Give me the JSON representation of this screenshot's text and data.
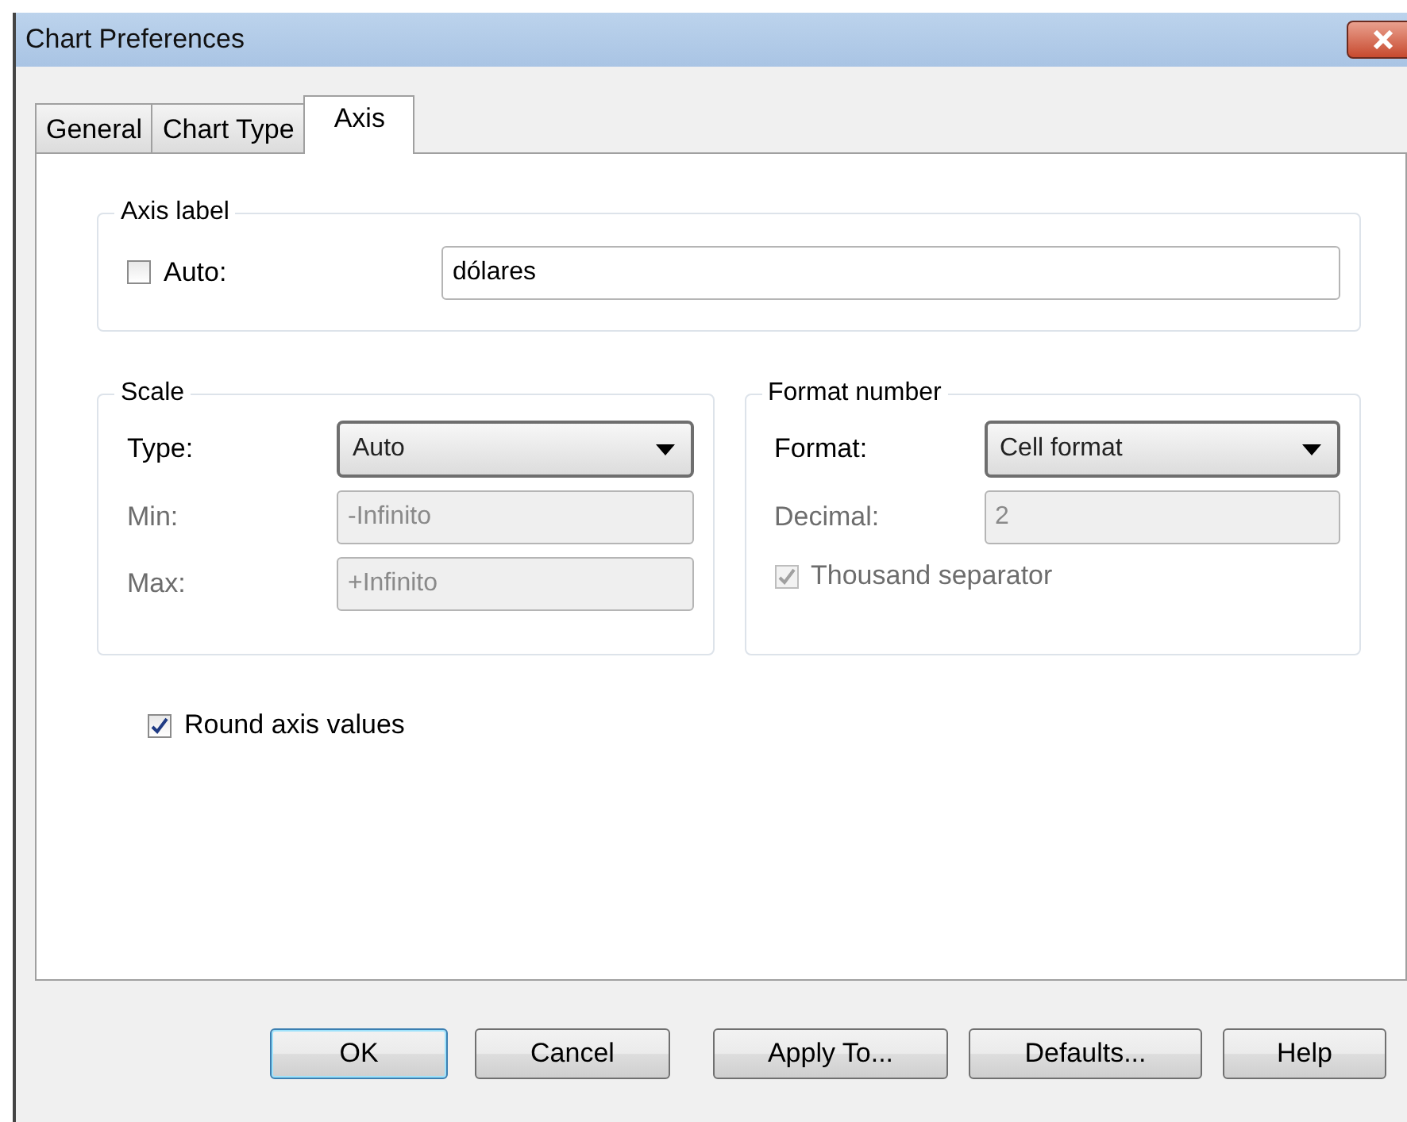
{
  "window": {
    "title": "Chart Preferences"
  },
  "tabs": [
    {
      "label": "General",
      "selected": false
    },
    {
      "label": "Chart Type",
      "selected": false
    },
    {
      "label": "Axis",
      "selected": true
    }
  ],
  "axis_label": {
    "title": "Axis label",
    "auto": {
      "label": "Auto:",
      "checked": false
    },
    "value": "dólares"
  },
  "scale": {
    "title": "Scale",
    "type": {
      "label": "Type:",
      "value": "Auto"
    },
    "min": {
      "label": "Min:",
      "value": "-Infinito",
      "disabled": true
    },
    "max": {
      "label": "Max:",
      "value": "+Infinito",
      "disabled": true
    }
  },
  "format_number": {
    "title": "Format number",
    "format": {
      "label": "Format:",
      "value": "Cell format"
    },
    "decimal": {
      "label": "Decimal:",
      "value": "2",
      "disabled": true
    },
    "thousand_separator": {
      "label": "Thousand separator",
      "checked": true,
      "disabled": true
    }
  },
  "round_axis_values": {
    "label": "Round axis values",
    "checked": true
  },
  "buttons": [
    {
      "label": "OK",
      "default": true
    },
    {
      "label": "Cancel",
      "default": false
    },
    {
      "label": "Apply To...",
      "default": false
    },
    {
      "label": "Defaults...",
      "default": false
    },
    {
      "label": "Help",
      "default": false
    }
  ]
}
